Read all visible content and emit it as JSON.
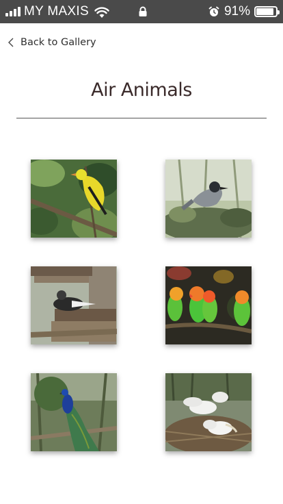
{
  "status_bar": {
    "carrier": "MY MAXIS",
    "battery_percent": "91%",
    "battery_level": 0.91,
    "icons": [
      "signal-icon",
      "wifi-icon",
      "lock-icon",
      "alarm-icon",
      "battery-icon"
    ]
  },
  "nav": {
    "back_label": "Back to Gallery",
    "back_icon": "chevron-left-icon"
  },
  "page": {
    "title": "Air Animals"
  },
  "gallery": {
    "items": [
      {
        "subject": "yellow oriole on branch"
      },
      {
        "subject": "grey heron on rocks"
      },
      {
        "subject": "duck on wooden feeder"
      },
      {
        "subject": "lovebirds on branch"
      },
      {
        "subject": "peacock"
      },
      {
        "subject": "pelicans in nest"
      }
    ]
  },
  "colors": {
    "status_bar_bg": "#4a4a4a",
    "title_text": "#3a2a2a",
    "page_bg": "#ffffff"
  }
}
